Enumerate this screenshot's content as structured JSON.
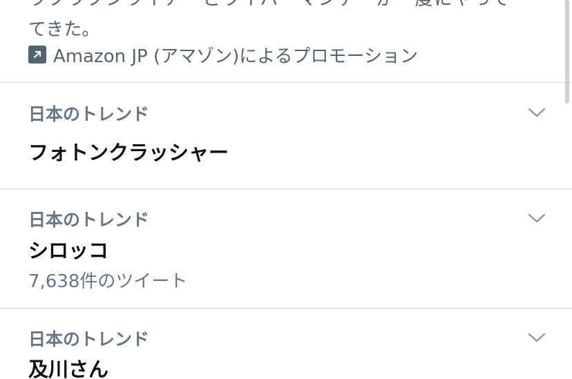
{
  "promotion": {
    "text_line1": "ラブラブシライア・とライバーマンデーが一度にやって",
    "text_line2": "てきた。",
    "icon": "promoted-arrow-icon",
    "label": "Amazon JP (アマゾン)によるプロモーション"
  },
  "trends": [
    {
      "context": "日本のトレンド",
      "name": "フォトンクラッシャー",
      "tweet_count": ""
    },
    {
      "context": "日本のトレンド",
      "name": "シロッコ",
      "tweet_count": "7,638件のツイート"
    },
    {
      "context": "日本のトレンド",
      "name": "及川さん",
      "tweet_count": ""
    }
  ],
  "colors": {
    "secondary_text": "#657786",
    "primary_text": "#111111",
    "divider": "#d7dbdf"
  }
}
